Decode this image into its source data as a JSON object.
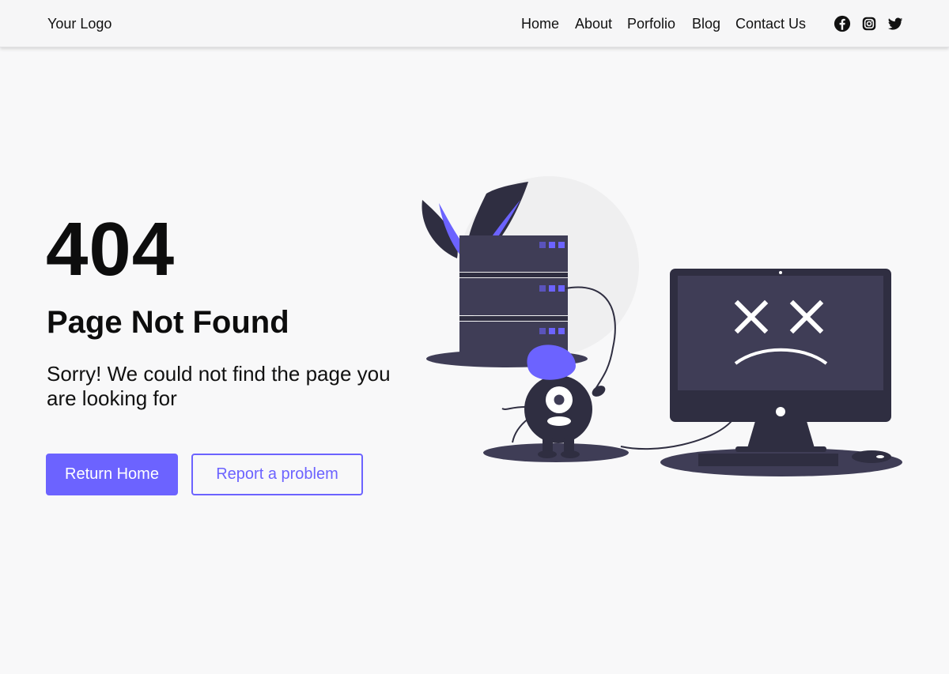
{
  "header": {
    "logo": "Your Logo",
    "nav": [
      "Home",
      "About",
      "Porfolio",
      "Blog",
      "Contact Us"
    ],
    "social_icons": [
      "facebook-icon",
      "instagram-icon",
      "twitter-icon"
    ]
  },
  "main": {
    "code": "404",
    "title": "Page Not Found",
    "message": "Sorry! We could not find the page you are looking for",
    "primary_button": "Return Home",
    "secondary_button": "Report a problem"
  },
  "colors": {
    "accent": "#6c63ff",
    "dark": "#3f3d56",
    "darker": "#2f2e41",
    "background": "#f8f8f9"
  }
}
